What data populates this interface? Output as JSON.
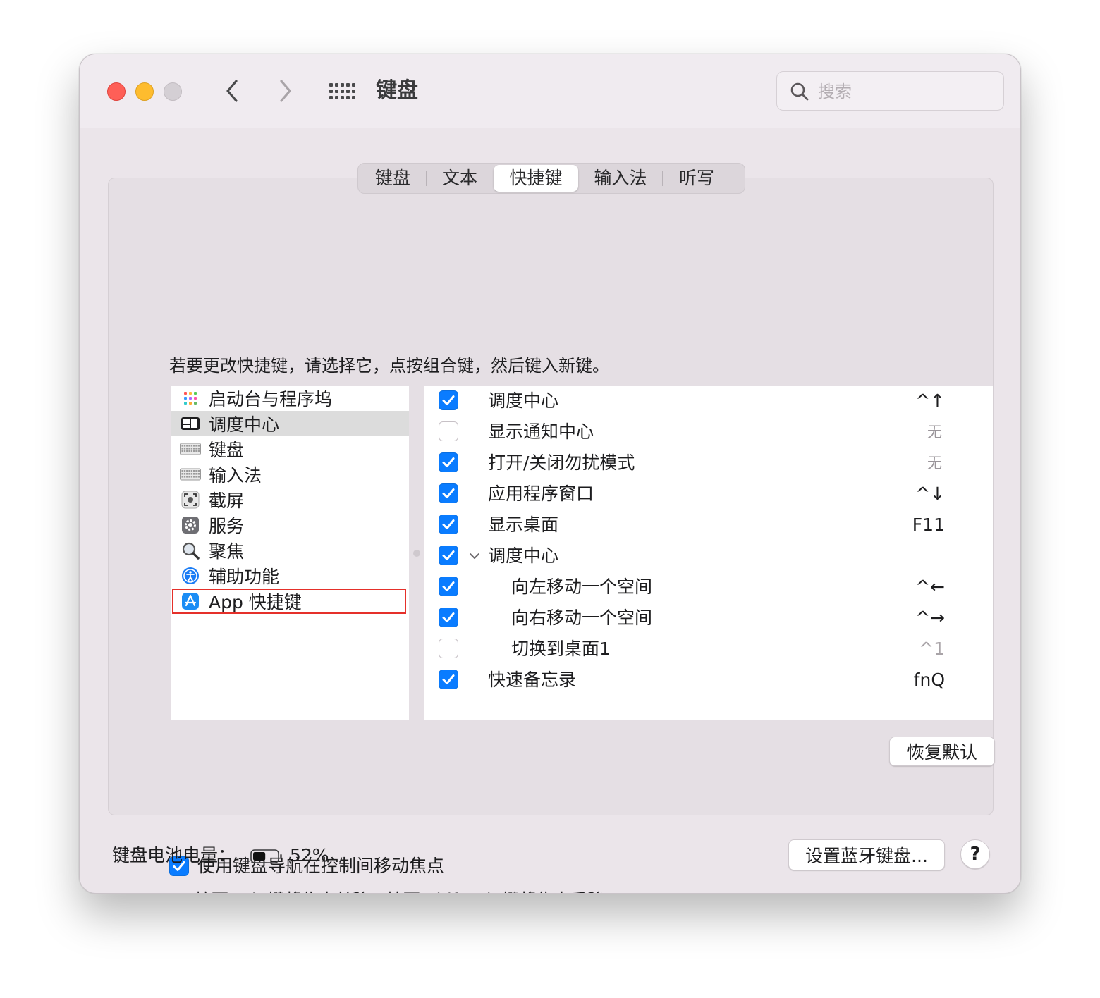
{
  "window": {
    "title": "键盘"
  },
  "search": {
    "placeholder": "搜索",
    "value": ""
  },
  "tabs": [
    {
      "label": "键盘",
      "active": false
    },
    {
      "label": "文本",
      "active": false
    },
    {
      "label": "快捷键",
      "active": true
    },
    {
      "label": "输入法",
      "active": false
    },
    {
      "label": "听写",
      "active": false
    }
  ],
  "instructions": "若要更改快捷键，请选择它，点按组合键，然后键入新键。",
  "categories": [
    {
      "label": "启动台与程序坞",
      "icon": "launchpad-icon"
    },
    {
      "label": "调度中心",
      "icon": "mission-control-icon",
      "selected": true
    },
    {
      "label": "键盘",
      "icon": "keyboard-icon"
    },
    {
      "label": "输入法",
      "icon": "input-method-icon"
    },
    {
      "label": "截屏",
      "icon": "screenshot-icon"
    },
    {
      "label": "服务",
      "icon": "services-gear-icon"
    },
    {
      "label": "聚焦",
      "icon": "spotlight-icon"
    },
    {
      "label": "辅助功能",
      "icon": "accessibility-icon"
    },
    {
      "label": "App 快捷键",
      "icon": "app-store-icon",
      "highlighted": true
    }
  ],
  "shortcuts": [
    {
      "label": "调度中心",
      "key": "^↑",
      "checked": true,
      "indent": 0
    },
    {
      "label": "显示通知中心",
      "key": "无",
      "checked": false,
      "indent": 0,
      "dim": true
    },
    {
      "label": "打开/关闭勿扰模式",
      "key": "无",
      "checked": true,
      "indent": 0,
      "dim": true
    },
    {
      "label": "应用程序窗口",
      "key": "^↓",
      "checked": true,
      "indent": 0
    },
    {
      "label": "显示桌面",
      "key": "F11",
      "checked": true,
      "indent": 0
    },
    {
      "label": "调度中心",
      "key": "",
      "checked": true,
      "indent": 0,
      "group": true
    },
    {
      "label": "向左移动一个空间",
      "key": "^←",
      "checked": true,
      "indent": 1
    },
    {
      "label": "向右移动一个空间",
      "key": "^→",
      "checked": true,
      "indent": 1
    },
    {
      "label": "切换到桌面1",
      "key": "^1",
      "checked": false,
      "indent": 1,
      "dimKey": true
    },
    {
      "label": "快速备忘录",
      "key": "fnQ",
      "checked": true,
      "indent": 0
    }
  ],
  "buttons": {
    "restore": "恢复默认",
    "bluetooth": "设置蓝牙键盘...",
    "help": "?"
  },
  "keyboard_nav": {
    "label": "使用键盘导航在控制间移动焦点",
    "checked": true,
    "description": "按下 Tab 键将焦点前移，按下 Shift-Tab 键将焦点后移。"
  },
  "battery": {
    "label": "键盘电池电量：",
    "percent": "52%",
    "level": 0.52
  },
  "colors": {
    "accent": "#0a7cff",
    "highlight_border": "#e5302a"
  }
}
